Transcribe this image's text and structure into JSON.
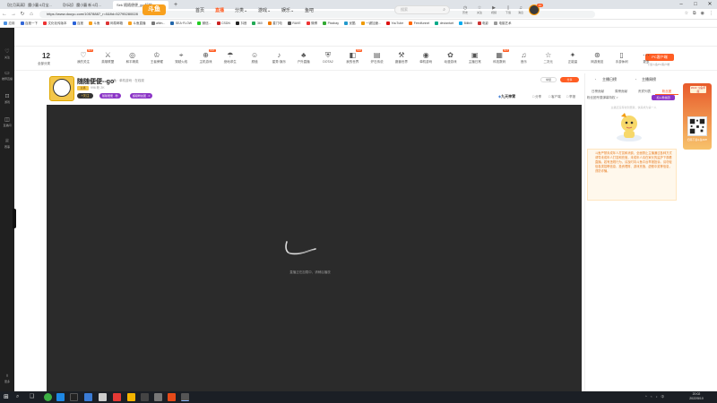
{
  "browser": {
    "tabs": [
      {
        "label": "【红月高清】 魔小蘑 6月宝..."
      },
      {
        "label": "【抖动】 魔小蘑 新 6月...",
        "active": false
      },
      {
        "label": "Sek 随随便便_go 好的...",
        "active": true
      }
    ],
    "new_tab": "+",
    "url": "https://www.douyu.com/10578887_r=0&fid=52795280028",
    "bookmarks": [
      "应用",
      "百度一下",
      "文化化传版本",
      "百度",
      "斗鱼",
      "网易邮箱",
      "斗鱼直播",
      "afilm...",
      "SEA·FLOW",
      "微信...",
      "CSDN",
      "抖音",
      "360",
      "星门电",
      "RAVE",
      "微博",
      "Pixabay",
      "优酷",
      "一键加速...",
      "YouTube",
      "Feedfunnel",
      "deviantart",
      "Bilibili",
      "电影",
      "电脑艺术"
    ]
  },
  "sidebar": {
    "items": [
      {
        "icon": "heart-icon",
        "label": "关注"
      },
      {
        "icon": "tv-icon",
        "label": "推荐直播"
      },
      {
        "icon": "lock-icon",
        "label": "游戏"
      },
      {
        "icon": "chat-icon",
        "label": "直播间"
      },
      {
        "icon": "trophy-icon",
        "label": "赛事"
      },
      {
        "icon": "bulb-icon",
        "label": "更多"
      }
    ]
  },
  "header": {
    "logo": "斗鱼",
    "nav": [
      "首页",
      "直播",
      "分类",
      "游戏",
      "娱乐",
      "鱼吧"
    ],
    "active_nav": "直播",
    "search_placeholder": "搜索",
    "user_icons": [
      {
        "icon": "clock-icon",
        "label": "历史"
      },
      {
        "icon": "star-icon",
        "label": "关注"
      },
      {
        "icon": "video-icon",
        "label": "视频"
      },
      {
        "icon": "phone-icon",
        "label": "下载"
      },
      {
        "icon": "bell-icon",
        "label": "消息"
      },
      {
        "icon": "podcast-icon",
        "label": "开播"
      }
    ],
    "avatar_badge": "LV"
  },
  "categories": {
    "count": "12",
    "count_label": "全部分类",
    "items": [
      {
        "label": "我的关注",
        "icon": "heart-icon",
        "hot": true
      },
      {
        "label": "英雄联盟",
        "icon": "sword-icon"
      },
      {
        "label": "和平精英",
        "icon": "target-icon"
      },
      {
        "label": "王者荣耀",
        "icon": "crown-icon"
      },
      {
        "label": "穿越火线",
        "icon": "gun-icon"
      },
      {
        "label": "主机游戏",
        "icon": "gamepad-icon",
        "hot": true
      },
      {
        "label": "绝地求生",
        "icon": "parachute-icon"
      },
      {
        "label": "颜值",
        "icon": "face-icon"
      },
      {
        "label": "星秀·娱乐",
        "icon": "music-icon"
      },
      {
        "label": "户外直播",
        "icon": "tree-icon"
      },
      {
        "label": "DOTA2",
        "icon": "shield-icon"
      },
      {
        "label": "我的世界",
        "icon": "cube-icon",
        "hot": true
      },
      {
        "label": "炉石传说",
        "icon": "card-icon"
      },
      {
        "label": "魔兽世界",
        "icon": "axe-icon"
      },
      {
        "label": "单机游戏",
        "icon": "disc-icon"
      },
      {
        "label": "动漫游戏",
        "icon": "anime-icon"
      },
      {
        "label": "主播日常",
        "icon": "camera-icon"
      },
      {
        "label": "科技数码",
        "icon": "chip-icon",
        "hot": true
      },
      {
        "label": "音乐",
        "icon": "note-icon"
      },
      {
        "label": "二次元",
        "icon": "star-icon"
      },
      {
        "label": "正能量",
        "icon": "thumb-icon"
      },
      {
        "label": "网游竞技",
        "icon": "controller-icon"
      },
      {
        "label": "手游休闲",
        "icon": "phone-icon"
      },
      {
        "label": "更多",
        "icon": "more-icon"
      }
    ],
    "pc_client": "PC客户端",
    "pc_client_sub": "下载斗鱼PC客户端"
  },
  "room": {
    "name": "随随便便--go",
    "meta": "斗鱼 · 单机游戏 · 在线观",
    "tag": "主播",
    "info2": "996 粉  2K",
    "follow": "+关注",
    "pill1": "随随便便 · 粉",
    "pill2": "超级粉丝团 · 0",
    "btn1": "举报",
    "btn2": "分享",
    "logo": "九天神霄",
    "tools": [
      "□ 分享",
      "□ 客户端",
      "□ 举报"
    ]
  },
  "player": {
    "loading_text": "直播正在加载中，请稍后播放"
  },
  "chat": {
    "rank_title": "主播日榜",
    "rank_title2": "主播周榜",
    "tabs": [
      "日榜贡献",
      "周榜贡献",
      "贵宾列表",
      "粉丝团"
    ],
    "active_tab": "粉丝团",
    "fans_row": "粉丝团专属弹幕特权 >",
    "fans_btn": "加入粉丝团",
    "empty_msg": "主播还没有收到贡献，快来成为第一人",
    "notice": "斗鱼严禁未成年人打赏和消费，全面禁止主播通过各种方式诱导未成年人打赏和充值，未成年人请在家长的监护下观看直播。若有违规行为，请及时向斗鱼平台举报投诉。请勿轻信各类招聘信息、投资理财、游戏充值、虚假中奖等信息，谨防诈骗。"
  },
  "float_ad": {
    "badge": "2022 斗鱼年度",
    "text": "扫码下载斗鱼APP"
  },
  "taskbar": {
    "tray": [
      "^",
      "⌁",
      "♪",
      "中"
    ],
    "time": "20:02",
    "date": "2022/5/10"
  }
}
